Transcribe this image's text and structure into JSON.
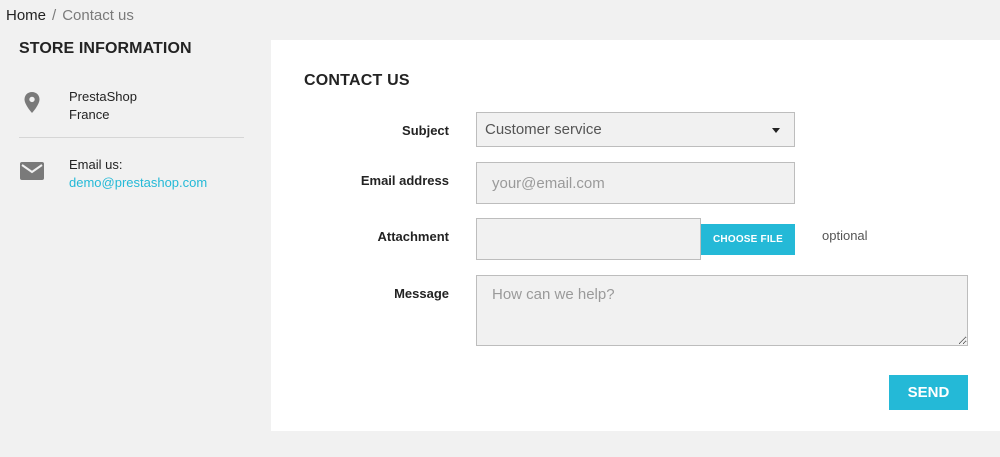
{
  "breadcrumb": {
    "home": "Home",
    "separator": "/",
    "current": "Contact us"
  },
  "sidebar": {
    "title": "STORE INFORMATION",
    "address": {
      "icon": "map-pin-icon",
      "line1": "PrestaShop",
      "line2": "France"
    },
    "email": {
      "icon": "envelope-icon",
      "label": "Email us:",
      "value": "demo@prestashop.com"
    }
  },
  "form": {
    "title": "CONTACT US",
    "subject": {
      "label": "Subject",
      "value": "Customer service"
    },
    "email": {
      "label": "Email address",
      "placeholder": "your@email.com"
    },
    "attachment": {
      "label": "Attachment",
      "button": "CHOOSE FILE",
      "note": "optional"
    },
    "message": {
      "label": "Message",
      "placeholder": "How can we help?"
    },
    "send": "SEND"
  },
  "colors": {
    "accent": "#24b9d7",
    "background": "#f1f1f1",
    "panel": "#ffffff",
    "text": "#232323"
  }
}
